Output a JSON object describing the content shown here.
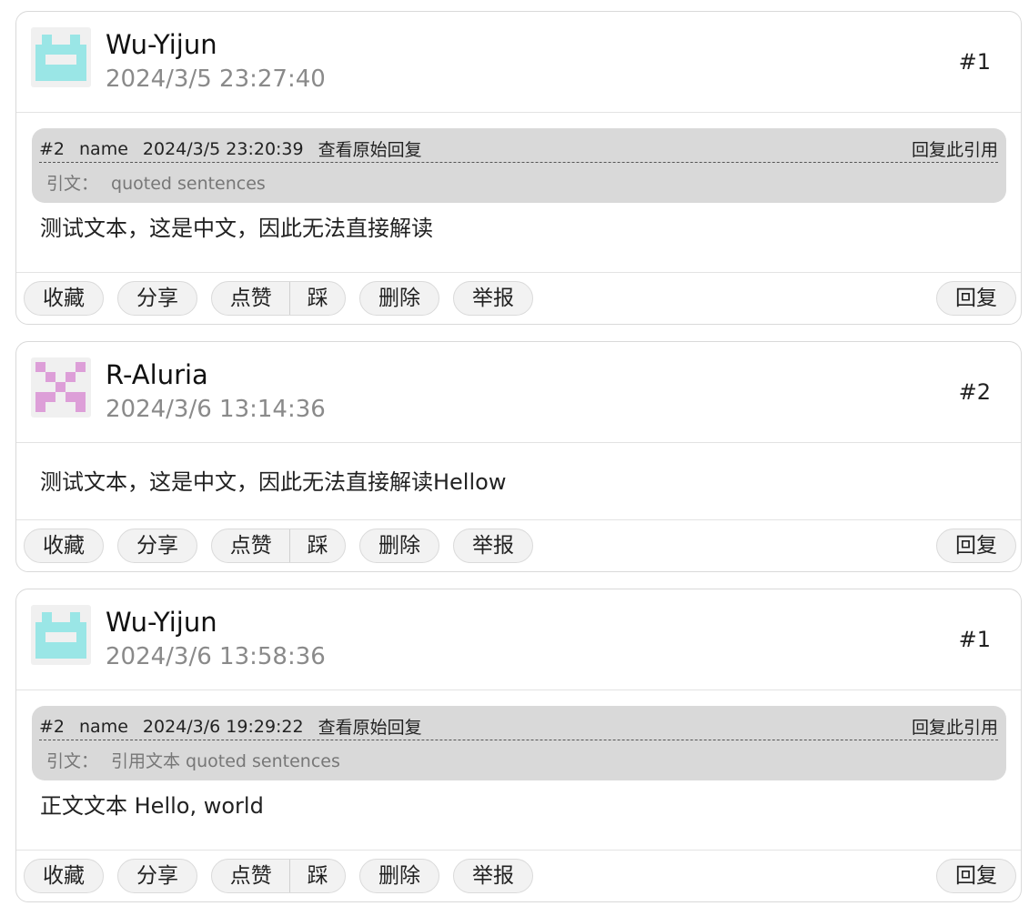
{
  "posts": [
    {
      "username": "Wu-Yijun",
      "time": "2024/3/5 23:27:40",
      "floor": "#1",
      "avatar_color": "#9ae6e6",
      "avatar_icon": "robot-pixel-avatar-icon",
      "quote": {
        "floor": "#2",
        "name": "name",
        "time": "2024/3/5 23:20:39",
        "view_label": "查看原始回复",
        "reply_label": "回复此引用",
        "label": "引文：",
        "text": "quoted sentences"
      },
      "content": "测试文本，这是中文，因此无法直接解读"
    },
    {
      "username": "R-Aluria",
      "time": "2024/3/6 13:14:36",
      "floor": "#2",
      "avatar_color": "#dd9fd8",
      "avatar_icon": "pixel-pattern-avatar-icon",
      "content": "测试文本，这是中文，因此无法直接解读Hellow"
    },
    {
      "username": "Wu-Yijun",
      "time": "2024/3/6 13:58:36",
      "floor": "#1",
      "avatar_color": "#9ae6e6",
      "avatar_icon": "robot-pixel-avatar-icon",
      "quote": {
        "floor": "#2",
        "name": "name",
        "time": "2024/3/6 19:29:22",
        "view_label": "查看原始回复",
        "reply_label": "回复此引用",
        "label": "引文：",
        "text": "引用文本 quoted sentences"
      },
      "content": "正文文本 Hello, world"
    }
  ],
  "actions": {
    "collect": "收藏",
    "share": "分享",
    "like": "点赞",
    "dislike": "踩",
    "delete": "删除",
    "report": "举报",
    "reply": "回复"
  }
}
